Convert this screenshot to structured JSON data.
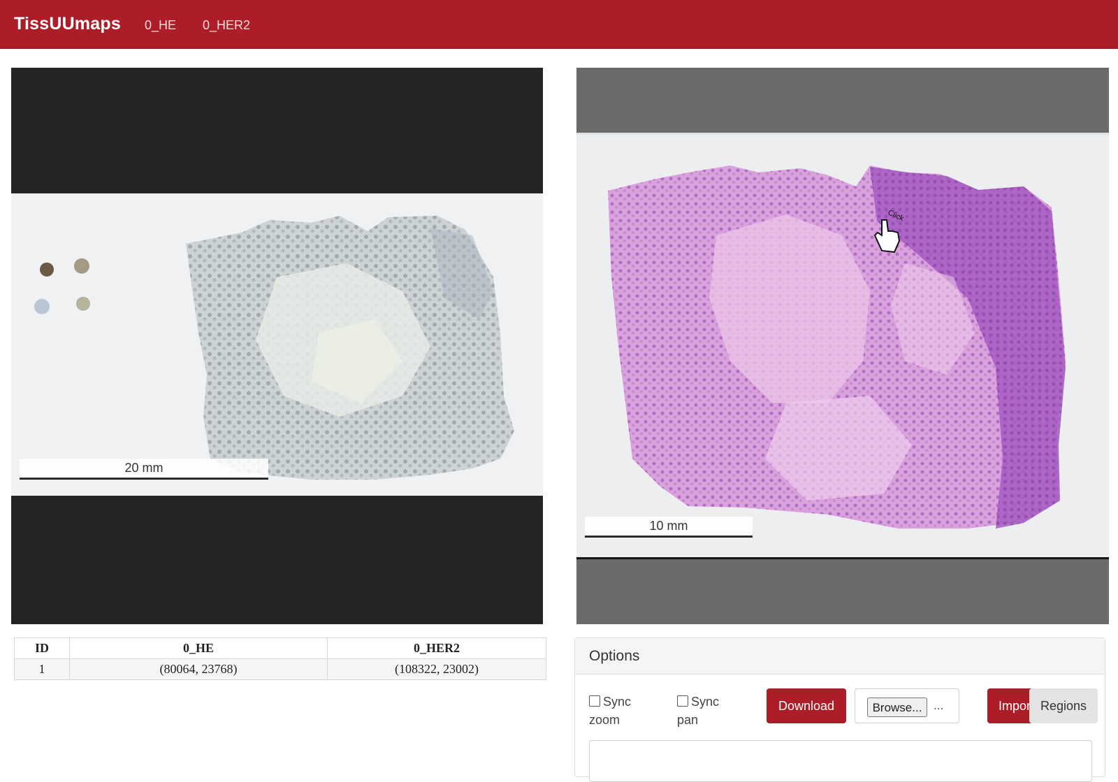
{
  "navbar": {
    "brand": "TissUUmaps",
    "links": [
      "0_HE",
      "0_HER2"
    ]
  },
  "viewers": {
    "left": {
      "scalebar": "20 mm"
    },
    "right": {
      "scalebar": "10 mm",
      "cursor_label": "Click"
    }
  },
  "table": {
    "headers": [
      "ID",
      "0_HE",
      "0_HER2"
    ],
    "rows": [
      [
        "1",
        "(80064, 23768)",
        "(108322, 23002)"
      ]
    ]
  },
  "options": {
    "title": "Options",
    "sync_zoom": {
      "line1": "Sync",
      "line2": "zoom",
      "checked": false
    },
    "sync_pan": {
      "line1": "Sync",
      "line2": "pan",
      "checked": false
    },
    "download_label": "Download",
    "browse_label": "Browse...",
    "file_text": "...",
    "import_label": "Impor",
    "regions_label": "Regions",
    "textarea_value": ""
  },
  "colors": {
    "brand_red": "#ad1d28",
    "he_stain": "#b95fc4",
    "her2_stain": "#9aa5a5"
  }
}
